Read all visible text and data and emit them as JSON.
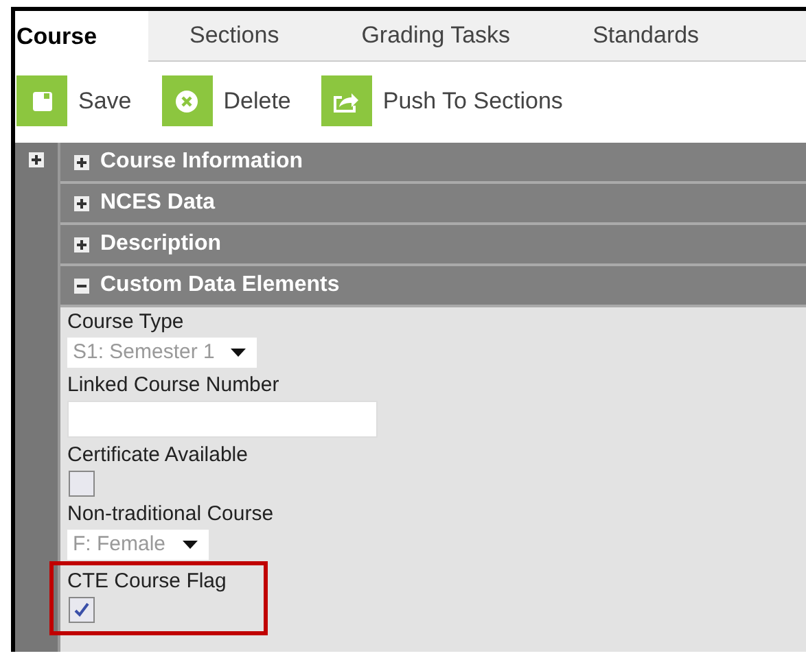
{
  "tabs": [
    {
      "label": "Course",
      "selected": true
    },
    {
      "label": "Sections",
      "selected": false
    },
    {
      "label": "Grading Tasks",
      "selected": false
    },
    {
      "label": "Standards",
      "selected": false
    }
  ],
  "toolbar": [
    {
      "kind": "save",
      "label": "Save"
    },
    {
      "kind": "delete",
      "label": "Delete"
    },
    {
      "kind": "push",
      "label": "Push To Sections"
    }
  ],
  "sections": [
    {
      "title": "Course Information",
      "expanded": false
    },
    {
      "title": "NCES Data",
      "expanded": false
    },
    {
      "title": "Description",
      "expanded": false
    },
    {
      "title": "Custom Data Elements",
      "expanded": true
    }
  ],
  "fields": [
    {
      "kind": "select",
      "label": "Course Type",
      "value": "S1: Semester 1",
      "highlighted": false
    },
    {
      "kind": "text",
      "label": "Linked Course Number",
      "highlighted": false
    },
    {
      "kind": "checkbox",
      "label": "Certificate Available",
      "checked": false,
      "highlighted": false
    },
    {
      "kind": "select",
      "label": "Non-traditional Course",
      "value": "F: Female",
      "highlighted": false
    },
    {
      "kind": "checkbox",
      "label": "CTE Course Flag",
      "checked": true,
      "highlighted": true
    }
  ]
}
